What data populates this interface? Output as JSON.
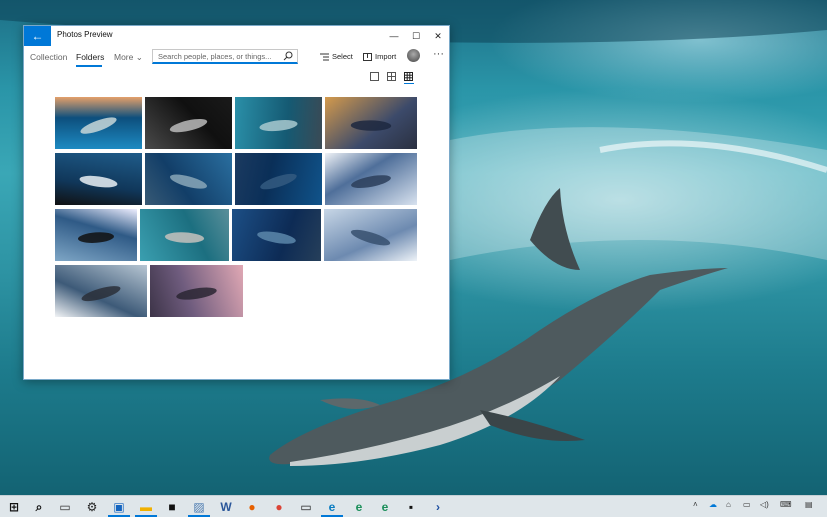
{
  "window": {
    "title": "Photos Preview",
    "back_icon": "back-arrow-icon",
    "controls": [
      "minimize",
      "maximize",
      "close"
    ],
    "control_glyphs": {
      "minimize": "—",
      "maximize": "☐",
      "close": "✕"
    }
  },
  "nav": {
    "tabs": [
      {
        "label": "Collection"
      },
      {
        "label": "Folders",
        "selected": true
      },
      {
        "label": "More"
      }
    ],
    "more_chevron": "⌄",
    "search": {
      "placeholder": "Search people, places, or things..."
    },
    "select_label": "Select",
    "import_label": "Import",
    "more_options": "···"
  },
  "view_options": [
    "single-view",
    "medium-grid",
    "small-grid"
  ],
  "selected_view": "small-grid",
  "photos": [
    {
      "name": "dolphin-reef"
    },
    {
      "name": "whale-tail-dark"
    },
    {
      "name": "dolphin-swimming"
    },
    {
      "name": "humpback-sunset"
    },
    {
      "name": "orca-jumping"
    },
    {
      "name": "dolphins-underwater"
    },
    {
      "name": "diver-deep-blue"
    },
    {
      "name": "humpback-breach"
    },
    {
      "name": "orca-splash"
    },
    {
      "name": "dolphin-pod"
    },
    {
      "name": "humpbacks-underwater"
    },
    {
      "name": "whale-leap-horizon"
    },
    {
      "name": "whale-breach-grey"
    },
    {
      "name": "whale-tail-sunset"
    }
  ],
  "colors": {
    "accent": "#0078d7",
    "taskbar": "#dfe6ea"
  },
  "taskbar": {
    "icons": [
      "start-icon",
      "search-icon",
      "task-view-icon",
      "settings-icon",
      "photos-icon",
      "file-explorer-icon",
      "store-icon",
      "photos-app-icon",
      "word-icon",
      "firefox-icon",
      "chrome-icon",
      "terminal-icon",
      "edge-icon",
      "edge-beta-icon",
      "edge-dev-icon",
      "cmd-icon",
      "powershell-icon"
    ],
    "tray": [
      "chevron-up-icon",
      "onedrive-icon",
      "network-icon",
      "display-icon",
      "volume-icon",
      "keyboard-icon",
      "notification-icon"
    ]
  }
}
